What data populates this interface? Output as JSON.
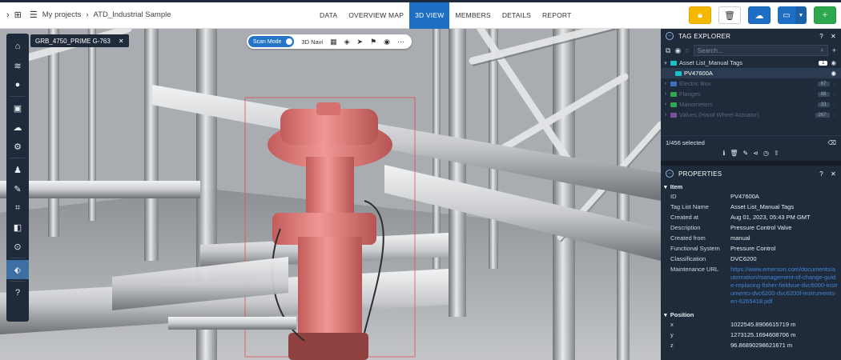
{
  "topbar": {
    "breadcrumb_root": "My projects",
    "breadcrumb_project": "ATD_Industrial Sample",
    "tabs": [
      {
        "label": "DATA",
        "active": false
      },
      {
        "label": "OVERVIEW MAP",
        "active": false
      },
      {
        "label": "3D VIEW",
        "active": true
      },
      {
        "label": "MEMBERS",
        "active": false
      },
      {
        "label": "DETAILS",
        "active": false
      },
      {
        "label": "REPORT",
        "active": false
      }
    ]
  },
  "viewer": {
    "tag_chip": "GRB_4750_PRIME G-763",
    "tag_chip_close": "✕",
    "scan_mode_label": "Scan Mode",
    "navi_label": "3D Navi"
  },
  "tag_explorer": {
    "title": "TAG EXPLORER",
    "help": "?",
    "close": "✕",
    "search_placeholder": "Search...",
    "tree": [
      {
        "label": "Asset List_Manual Tags",
        "count": "1",
        "color": "#19c3c3",
        "expanded": true,
        "dim": false
      },
      {
        "label": "PV47600A",
        "count": "",
        "color": "#19c3c3",
        "child": true,
        "selected": true
      },
      {
        "label": "Electric Box",
        "count": "67",
        "color": "#3f6fbf",
        "dim": true
      },
      {
        "label": "Flanges",
        "count": "88",
        "color": "#2fa84f",
        "dim": true
      },
      {
        "label": "Manometers",
        "count": "33",
        "color": "#2fa84f",
        "dim": true
      },
      {
        "label": "Valves (Hand Wheel Actuator)",
        "count": "267",
        "color": "#7b4fa3",
        "dim": true
      }
    ],
    "selection_text": "1/456 selected"
  },
  "properties": {
    "title": "PROPERTIES",
    "help": "?",
    "close": "✕",
    "item_section": "Item",
    "rows": [
      {
        "key": "ID",
        "value": "PV47600A"
      },
      {
        "key": "Tag List Name",
        "value": "Asset List_Manual Tags"
      },
      {
        "key": "Created at",
        "value": "Aug 01, 2023, 05:43 PM GMT"
      },
      {
        "key": "Description",
        "value": "Pressure Control Valve"
      },
      {
        "key": "Created from",
        "value": "manual"
      },
      {
        "key": "Functional System",
        "value": "Pressure Control"
      },
      {
        "key": "Classification",
        "value": "DVC6200"
      }
    ],
    "url_key": "Maintenance URL",
    "url_value": "https://www.emerson.com/documents/automation/management-of-change-guide-replacing-fisher-fieldvue-dvc6000-instruments-dvc6200-dvc6200f-instruments-en-6265418.pdf",
    "position_section": "Position",
    "position": [
      {
        "key": "x",
        "value": "1022545.8906615719 m"
      },
      {
        "key": "y",
        "value": "1273125.1694608706 m"
      },
      {
        "key": "z",
        "value": "96.86890298621671 m"
      }
    ]
  },
  "colors": {
    "panel_bg": "#1f2a3a",
    "active_tab": "#1c6fc4",
    "highlight_object": "#e8807f"
  }
}
